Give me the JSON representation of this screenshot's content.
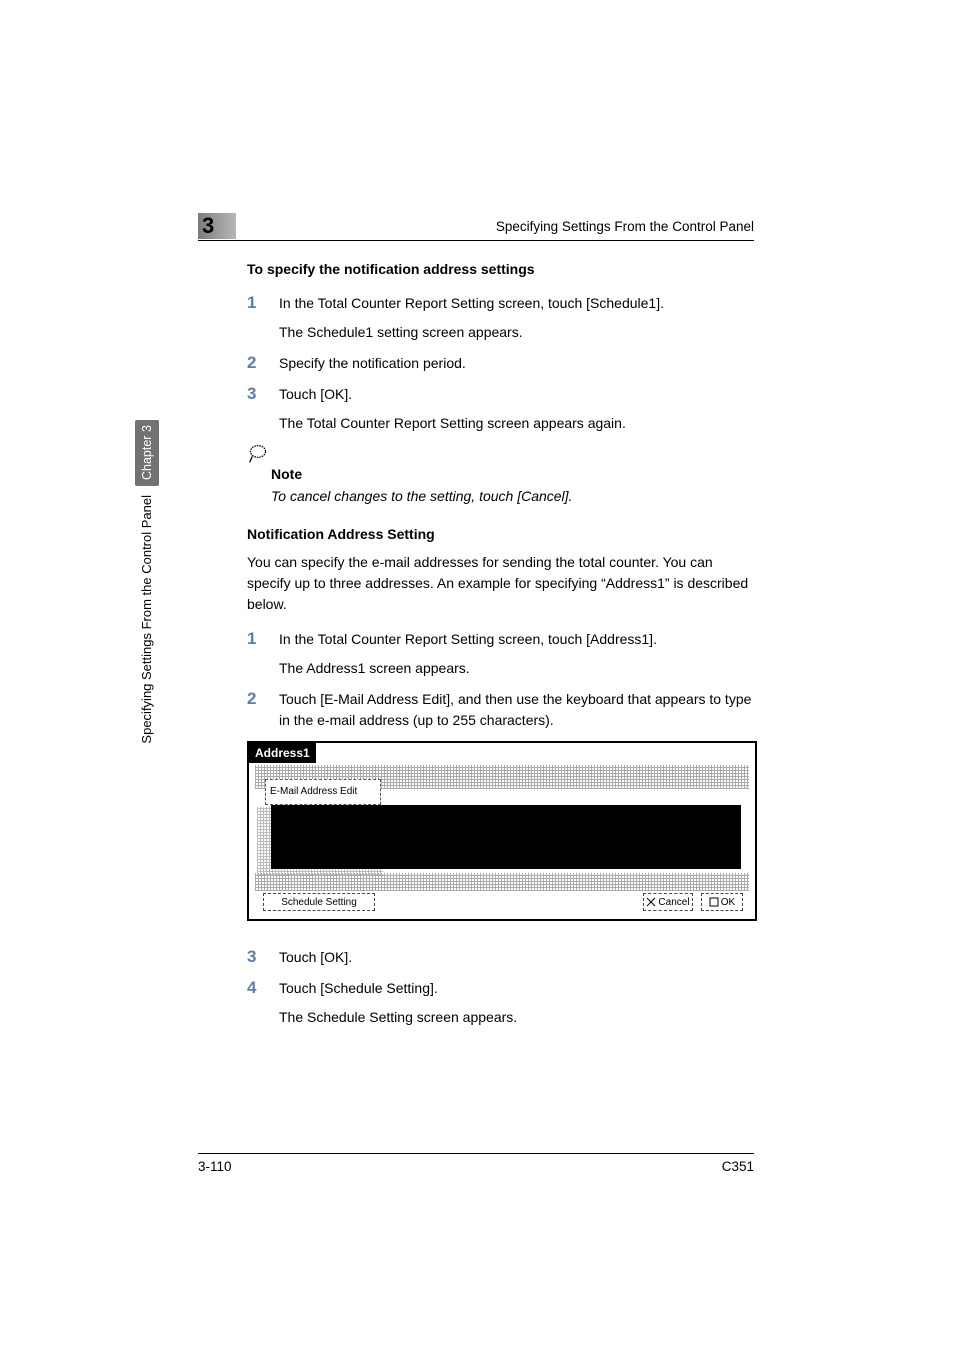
{
  "chapter_badge": "3",
  "header_right": "Specifying Settings From the Control Panel",
  "side_tab": "Chapter 3",
  "side_text": "Specifying Settings From the Control Panel",
  "section1": {
    "heading": "To specify the notification address settings",
    "steps": [
      {
        "num": "1",
        "line1": "In the Total Counter Report Setting screen, touch [Schedule1].",
        "line2": "The Schedule1 setting screen appears."
      },
      {
        "num": "2",
        "line1": "Specify the notification period."
      },
      {
        "num": "3",
        "line1": "Touch [OK].",
        "line2": "The Total Counter Report Setting screen appears again."
      }
    ]
  },
  "note": {
    "title": "Note",
    "body": "To cancel changes to the setting, touch [Cancel]."
  },
  "section2": {
    "heading": "Notification Address Setting",
    "intro": "You can specify the e-mail addresses for sending the total counter. You can specify up to three addresses. An example for specifying “Address1” is described below.",
    "steps_a": [
      {
        "num": "1",
        "line1": "In the Total Counter Report Setting screen, touch [Address1].",
        "line2": "The Address1 screen appears."
      },
      {
        "num": "2",
        "line1": "Touch [E-Mail Address Edit], and then use the keyboard that appears to type in the e-mail address (up to 255 characters)."
      }
    ],
    "steps_b": [
      {
        "num": "3",
        "line1": "Touch [OK]."
      },
      {
        "num": "4",
        "line1": "Touch [Schedule Setting].",
        "line2": "The Schedule Setting screen appears."
      }
    ]
  },
  "device": {
    "title": "Address1",
    "email_btn": "E-Mail Address Edit",
    "schedule_btn": "Schedule Setting",
    "cancel_btn": "Cancel",
    "ok_btn": "OK"
  },
  "footer": {
    "left": "3-110",
    "right": "C351"
  }
}
